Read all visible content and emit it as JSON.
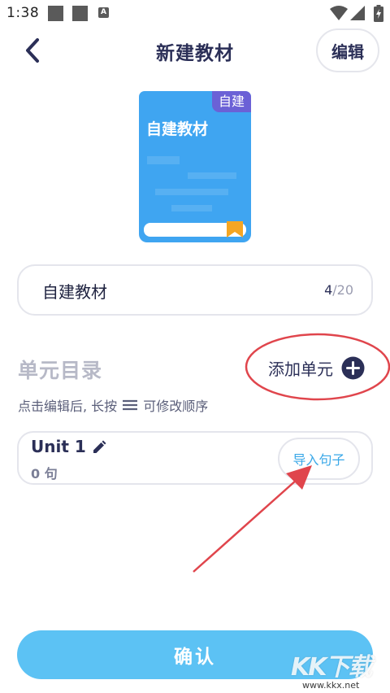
{
  "status_bar": {
    "time": "1:38",
    "badge_letter": "A",
    "icons": [
      "notification-square-icon",
      "notification-square-icon",
      "app-a-icon",
      "wifi-icon",
      "signal-icon",
      "battery-charging-icon"
    ]
  },
  "header": {
    "title": "新建教材",
    "edit_label": "编辑",
    "back_icon": "chevron-left-icon"
  },
  "book": {
    "badge": "自建",
    "title": "自建教材",
    "color": "#3fa5f1",
    "badge_color": "#6b61d6",
    "bookmark_color": "#f5a623"
  },
  "name_field": {
    "value": "自建教材",
    "count": "4",
    "max": "/20"
  },
  "units_section": {
    "title": "单元目录",
    "add_label": "添加单元",
    "hint_before": "点击编辑后, 长按",
    "hint_after": "可修改顺序"
  },
  "units": [
    {
      "name": "Unit 1",
      "count": "0 句",
      "import_label": "导入句子"
    }
  ],
  "footer": {
    "confirm_label": "确认"
  },
  "watermark": {
    "logo": "KK下载",
    "url": "www.kkx.net"
  },
  "colors": {
    "accent": "#5cc2f4",
    "primary_text": "#2b2f57",
    "annotation": "#e0454c"
  }
}
